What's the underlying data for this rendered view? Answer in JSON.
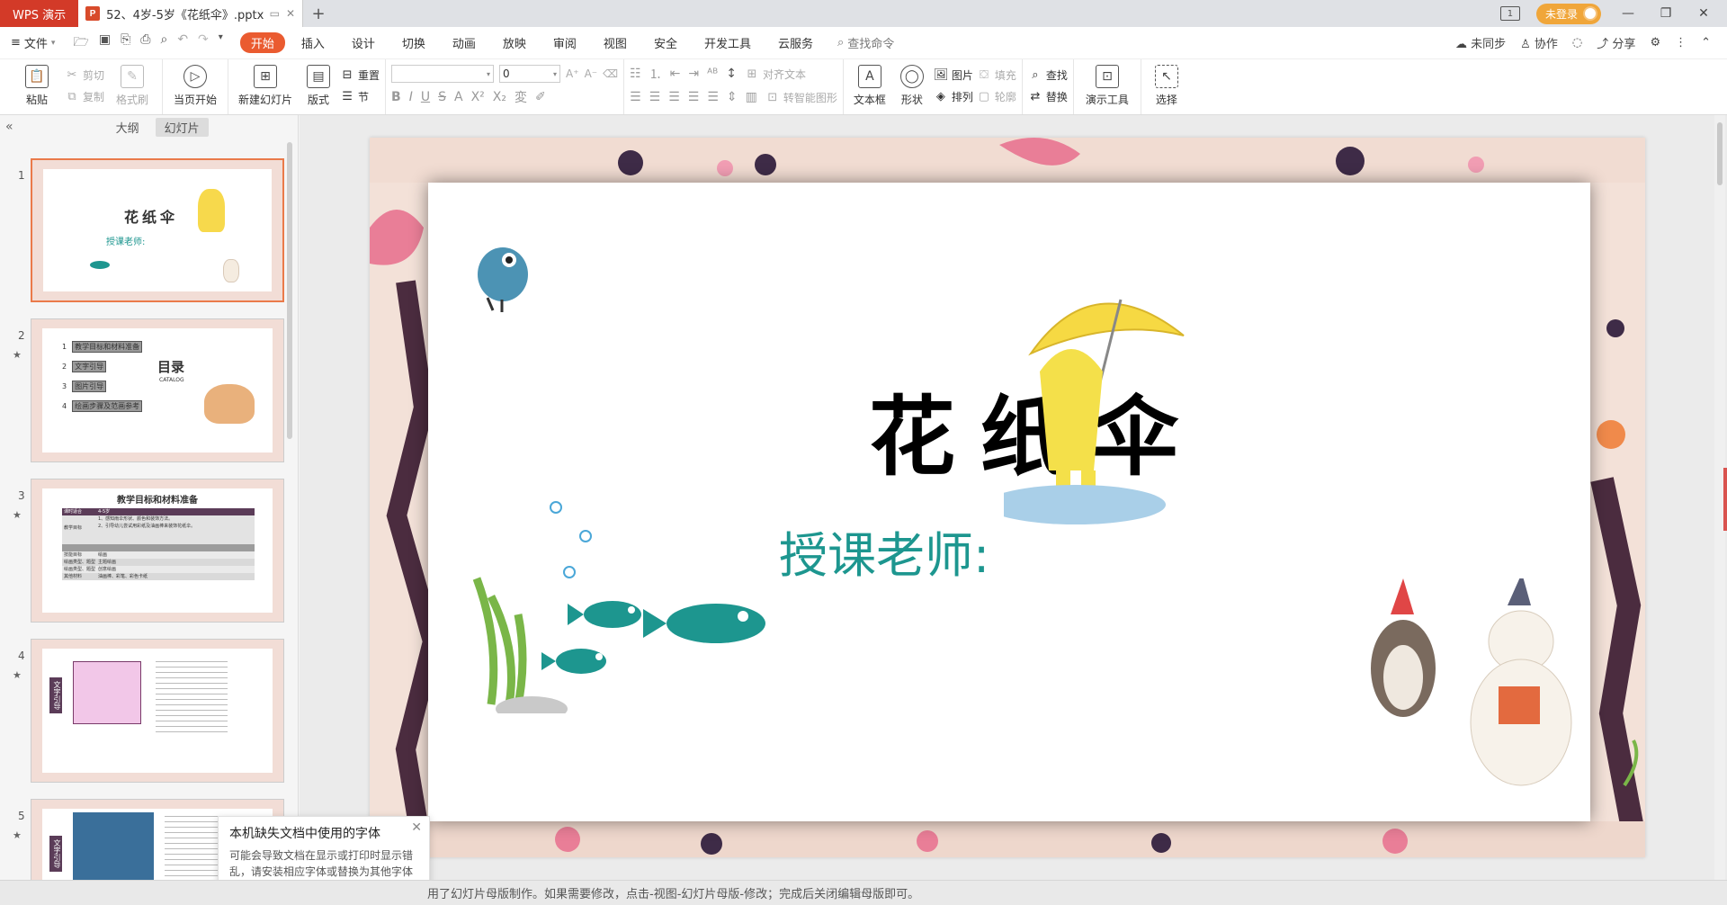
{
  "titlebar": {
    "app_name": "WPS 演示",
    "doc_icon": "P",
    "doc_title": "52、4岁-5岁《花纸伞》.pptx",
    "new_tab": "+",
    "login_label": "未登录"
  },
  "menubar": {
    "file_label": "文件",
    "tabs": [
      "开始",
      "插入",
      "设计",
      "切换",
      "动画",
      "放映",
      "审阅",
      "视图",
      "安全",
      "开发工具",
      "云服务"
    ],
    "active_tab": "开始",
    "search_label": "查找命令",
    "right": {
      "sync": "未同步",
      "collab": "协作",
      "share": "分享"
    }
  },
  "ribbon": {
    "paste": "粘贴",
    "cut": "剪切",
    "copy": "复制",
    "format_painter": "格式刷",
    "from_start": "当页开始",
    "new_slide": "新建幻灯片",
    "layout": "版式",
    "reset": "重置",
    "section": "节",
    "font_size": "0",
    "align_text": "对齐文本",
    "smart_art": "转智能图形",
    "text_box": "文本框",
    "shape": "形状",
    "picture": "图片",
    "arrange": "排列",
    "fill": "填充",
    "outline": "轮廓",
    "find": "查找",
    "replace": "替换",
    "present_tools": "演示工具",
    "select": "选择"
  },
  "left_panel": {
    "tab_outline": "大纲",
    "tab_slides": "幻灯片",
    "thumbnails": [
      {
        "num": "1",
        "title": "花纸伞",
        "subtitle": "授课老师:"
      },
      {
        "num": "2",
        "title": "目录",
        "subtitle": "CATALOG",
        "items": [
          "教学目标和材料准备",
          "文字引导",
          "图片引导",
          "绘画步骤及范画参考"
        ],
        "item_nums": [
          "1",
          "2",
          "3",
          "4"
        ]
      },
      {
        "num": "3",
        "title": "教学目标和材料准备",
        "rows": [
          "课时适合",
          "4-5岁",
          "教学目标",
          "1、感知雨伞形状、颜色和装饰方法。",
          "2、引导幼儿尝试用彩纸及油画棒来装饰花纸伞。",
          "技能目标",
          "绘画",
          "绘画类型、题型",
          "主题绘画",
          "绘画类型、题型",
          "创意绘画",
          "其他材料",
          "油画棒、彩笔、彩色卡纸"
        ]
      },
      {
        "num": "4",
        "label": "文字引导"
      },
      {
        "num": "5",
        "label": "文字引导"
      }
    ]
  },
  "slide": {
    "title": "花纸伞",
    "subtitle": "授课老师:"
  },
  "notification": {
    "title": "本机缺失文档中使用的字体",
    "body": "可能会导致文档在显示或打印时显示错乱，请安装相应字体或替换为其他字体"
  },
  "status": {
    "message": "用了幻灯片母版制作。如果需要修改，点击-视图-幻灯片母版-修改；完成后关闭编辑母版即可。"
  },
  "colors": {
    "wps_red": "#d33a28",
    "active_tab": "#ea5b30",
    "subtitle_teal": "#1d968f",
    "login_orange": "#f0a63a"
  }
}
